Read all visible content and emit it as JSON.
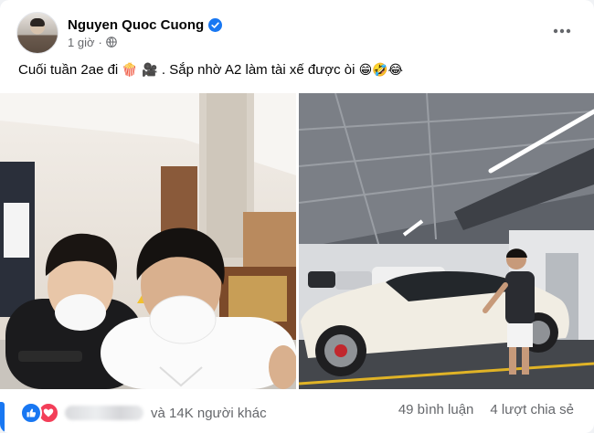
{
  "post": {
    "author_name": "Nguyen Quoc Cuong",
    "timestamp": "1 giờ",
    "separator": "·",
    "caption_text_1": "Cuối tuần 2ae đi ",
    "caption_emoji_1": "🍿 🎥",
    "caption_text_2": " . Sắp nhờ A2 làm tài xế được òi ",
    "caption_emoji_2": "😁🤣😂"
  },
  "engagement": {
    "reaction_summary": "và 14K người khác",
    "comments": "49 bình luận",
    "shares": "4 lượt chia sẻ"
  },
  "colors": {
    "accent": "#1877f2",
    "love": "#f33e58",
    "secondary_text": "#65676b"
  },
  "icons": [
    "verified-badge-icon",
    "globe-icon",
    "more-options-icon",
    "like-reaction-icon",
    "love-reaction-icon"
  ]
}
